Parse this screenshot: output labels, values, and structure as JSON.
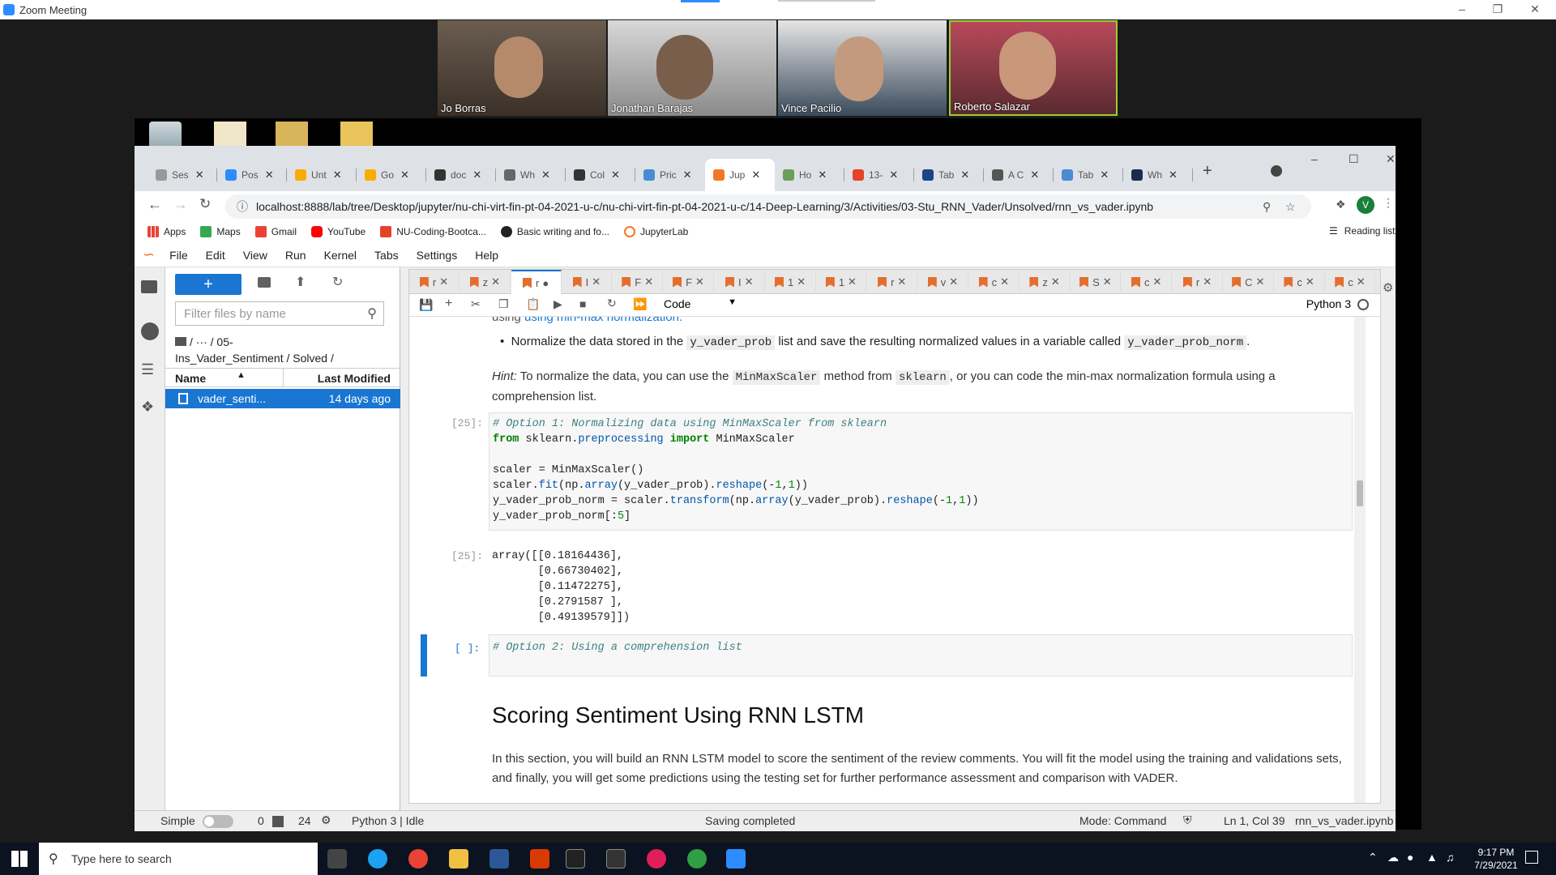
{
  "zoom": {
    "title": "Zoom Meeting",
    "participants": [
      "Jo Borras",
      "Jonathan Barajas",
      "Vince Pacilio",
      "Roberto Salazar"
    ]
  },
  "browser": {
    "tabs": [
      {
        "label": "Ses",
        "fav": "#999"
      },
      {
        "label": "Pos",
        "fav": "#2d8cff"
      },
      {
        "label": "Unt",
        "fav": "#f9ab00"
      },
      {
        "label": "Go",
        "fav": "#f9ab00"
      },
      {
        "label": "doc",
        "fav": "#333"
      },
      {
        "label": "Wh",
        "fav": "#666"
      },
      {
        "label": "Col",
        "fav": "#333"
      },
      {
        "label": "Pric",
        "fav": "#4a8cd1"
      },
      {
        "label": "Jup",
        "fav": "#f37726"
      },
      {
        "label": "Ho",
        "fav": "#6a9e5b"
      },
      {
        "label": "13-",
        "fav": "#e24329"
      },
      {
        "label": "Tab",
        "fav": "#1c4587"
      },
      {
        "label": "A C",
        "fav": "#555"
      },
      {
        "label": "Tab",
        "fav": "#4a8cd1"
      },
      {
        "label": "Wh",
        "fav": "#1c2a4d"
      }
    ],
    "url": "localhost:8888/lab/tree/Desktop/jupyter/nu-chi-virt-fin-pt-04-2021-u-c/nu-chi-virt-fin-pt-04-2021-u-c/14-Deep-Learning/3/Activities/03-Stu_RNN_Vader/Unsolved/rnn_vs_vader.ipynb",
    "profile_initial": "V",
    "bookmarks": [
      "Apps",
      "Maps",
      "Gmail",
      "YouTube",
      "NU-Coding-Bootca...",
      "Basic writing and fo...",
      "JupyterLab"
    ],
    "reading_list": "Reading list"
  },
  "jupyter": {
    "menu": [
      "File",
      "Edit",
      "View",
      "Run",
      "Kernel",
      "Tabs",
      "Settings",
      "Help"
    ],
    "filter_placeholder": "Filter files by name",
    "breadcrumb_line1": "/ ··· / 05-",
    "breadcrumb_line2": "Ins_Vader_Sentiment / Solved /",
    "col_name": "Name",
    "col_modified": "Last Modified",
    "file": {
      "name": "vader_senti...",
      "modified": "14 days ago"
    },
    "nb_tabs": [
      "r",
      "z",
      "r",
      "I",
      "F",
      "F",
      "I",
      "1",
      "1",
      "r",
      "v",
      "c",
      "z",
      "S",
      "c",
      "r",
      "C",
      "c",
      "c"
    ],
    "cell_type": "Code",
    "kernel": "Python 3",
    "md_top": "using min-max normalization.",
    "bullet_pre": "Normalize the data stored in the",
    "bullet_code1": "y_vader_prob",
    "bullet_mid": "list and save the resulting normalized values in a variable called",
    "bullet_code2": "y_vader_prob_norm",
    "bullet_end": ".",
    "hint_label": "Hint:",
    "hint_1": "To normalize the data, you can use the",
    "hint_code1": "MinMaxScaler",
    "hint_2": "method from",
    "hint_code2": "sklearn",
    "hint_3": ", or you can code the min-max normalization formula using a",
    "hint_4": "comprehension list.",
    "cell1_prompt": "[25]:",
    "out_prompt": "[25]:",
    "output_lines": [
      "array([[0.18164436],",
      "       [0.66730402],",
      "       [0.11472275],",
      "       [0.2791587 ],",
      "       [0.49139579]])"
    ],
    "cell2_prompt": "[ ]:",
    "cell2_code": "# Option 2: Using a comprehension list",
    "heading": "Scoring Sentiment Using RNN LSTM",
    "para": "In this section, you will build an RNN LSTM model to score the sentiment of the review comments. You will fit the model using the training and validations sets, and finally, you will get some predictions using the testing set for further performance assessment and comparison with VADER."
  },
  "status": {
    "simple": "Simple",
    "count0": "0",
    "count24": "24",
    "kernel_state": "Python 3 | Idle",
    "saving": "Saving completed",
    "mode": "Mode: Command",
    "cursor": "Ln 1, Col 39",
    "filename": "rnn_vs_vader.ipynb"
  },
  "taskbar": {
    "search": "Type here to search",
    "time": "9:17 PM",
    "date": "7/29/2021"
  }
}
